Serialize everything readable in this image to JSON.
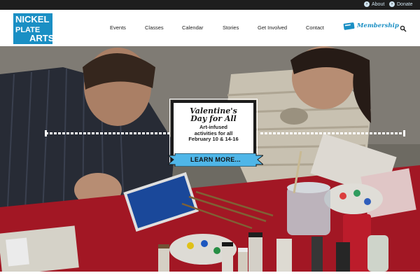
{
  "topbar": {
    "about_label": "About",
    "donate_label": "Donate",
    "background": "#1e1e1e",
    "link_color": "#cfe3ef"
  },
  "logo": {
    "line1": "NICKEL",
    "line2": "PLATE",
    "line3": "ARTS",
    "color": "#1a8fc4"
  },
  "nav": {
    "items": [
      "Events",
      "Classes",
      "Calendar",
      "Stories",
      "Get Involved",
      "Contact"
    ],
    "membership_label": "Membership",
    "search_icon": "search-icon"
  },
  "hero": {
    "promo_title_line1": "Valentine's",
    "promo_title_line2": "Day for All",
    "promo_text_line1": "Art-infused",
    "promo_text_line2": "activities for all",
    "promo_text_line3": "February 10 & 14-16",
    "cta_label": "LEARN MORE...",
    "cta_color": "#4fb6e8"
  }
}
